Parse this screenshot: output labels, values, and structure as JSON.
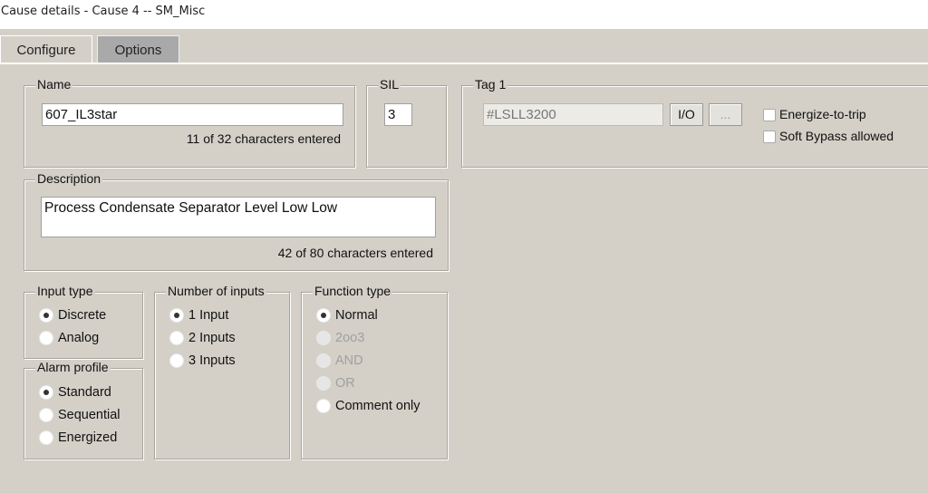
{
  "window": {
    "title": "Cause details - Cause 4 -- SM_Misc"
  },
  "tabs": [
    {
      "label": "Configure",
      "active": true
    },
    {
      "label": "Options",
      "active": false
    }
  ],
  "name": {
    "label": "Name",
    "value": "607_IL3star",
    "count": "11 of 32 characters entered"
  },
  "sil": {
    "label": "SIL",
    "value": "3"
  },
  "tag": {
    "label": "Tag 1",
    "value": "#LSLL3200",
    "io_button": "I/O",
    "browse_button": "...",
    "energize_label": "Energize-to-trip",
    "energize_checked": false,
    "bypass_label": "Soft Bypass allowed",
    "bypass_checked": false
  },
  "description": {
    "label": "Description",
    "value": "Process Condensate Separator Level Low Low",
    "count": "42 of 80 characters entered"
  },
  "input_type": {
    "label": "Input type",
    "options": [
      "Discrete",
      "Analog"
    ],
    "selected": "Discrete"
  },
  "alarm_profile": {
    "label": "Alarm profile",
    "options": [
      "Standard",
      "Sequential",
      "Energized"
    ],
    "selected": "Standard"
  },
  "num_inputs": {
    "label": "Number of inputs",
    "options": [
      "1 Input",
      "2 Inputs",
      "3 Inputs"
    ],
    "selected": "1 Input"
  },
  "function_type": {
    "label": "Function type",
    "options": [
      "Normal",
      "2oo3",
      "AND",
      "OR",
      "Comment only"
    ],
    "disabled": [
      "2oo3",
      "AND",
      "OR"
    ],
    "selected": "Normal"
  }
}
